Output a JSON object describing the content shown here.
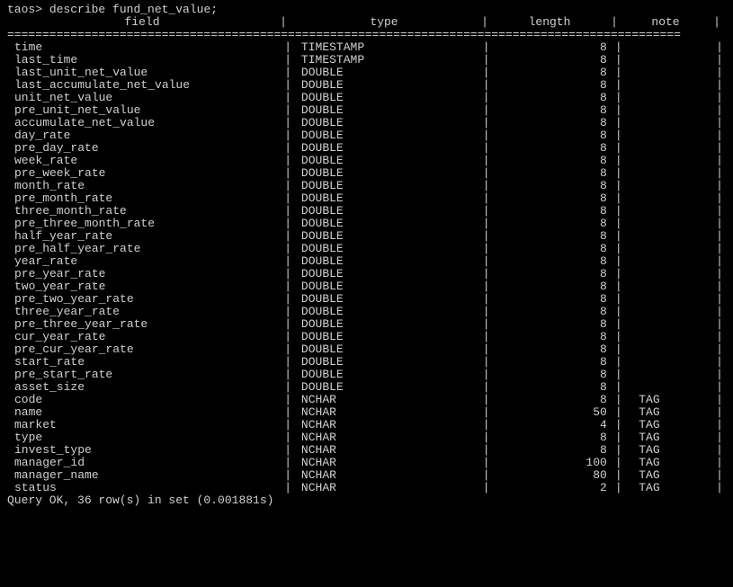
{
  "prompt": "taos>",
  "command": "describe fund_net_value;",
  "columns": {
    "field": "field",
    "type": "type",
    "length": "length",
    "note": "note"
  },
  "separator_line": "================================================================================================",
  "bar": "|",
  "rows": [
    {
      "field": "time",
      "type": "TIMESTAMP",
      "length": "8",
      "note": ""
    },
    {
      "field": "last_time",
      "type": "TIMESTAMP",
      "length": "8",
      "note": ""
    },
    {
      "field": "last_unit_net_value",
      "type": "DOUBLE",
      "length": "8",
      "note": ""
    },
    {
      "field": "last_accumulate_net_value",
      "type": "DOUBLE",
      "length": "8",
      "note": ""
    },
    {
      "field": "unit_net_value",
      "type": "DOUBLE",
      "length": "8",
      "note": ""
    },
    {
      "field": "pre_unit_net_value",
      "type": "DOUBLE",
      "length": "8",
      "note": ""
    },
    {
      "field": "accumulate_net_value",
      "type": "DOUBLE",
      "length": "8",
      "note": ""
    },
    {
      "field": "day_rate",
      "type": "DOUBLE",
      "length": "8",
      "note": ""
    },
    {
      "field": "pre_day_rate",
      "type": "DOUBLE",
      "length": "8",
      "note": ""
    },
    {
      "field": "week_rate",
      "type": "DOUBLE",
      "length": "8",
      "note": ""
    },
    {
      "field": "pre_week_rate",
      "type": "DOUBLE",
      "length": "8",
      "note": ""
    },
    {
      "field": "month_rate",
      "type": "DOUBLE",
      "length": "8",
      "note": ""
    },
    {
      "field": "pre_month_rate",
      "type": "DOUBLE",
      "length": "8",
      "note": ""
    },
    {
      "field": "three_month_rate",
      "type": "DOUBLE",
      "length": "8",
      "note": ""
    },
    {
      "field": "pre_three_month_rate",
      "type": "DOUBLE",
      "length": "8",
      "note": ""
    },
    {
      "field": "half_year_rate",
      "type": "DOUBLE",
      "length": "8",
      "note": ""
    },
    {
      "field": "pre_half_year_rate",
      "type": "DOUBLE",
      "length": "8",
      "note": ""
    },
    {
      "field": "year_rate",
      "type": "DOUBLE",
      "length": "8",
      "note": ""
    },
    {
      "field": "pre_year_rate",
      "type": "DOUBLE",
      "length": "8",
      "note": ""
    },
    {
      "field": "two_year_rate",
      "type": "DOUBLE",
      "length": "8",
      "note": ""
    },
    {
      "field": "pre_two_year_rate",
      "type": "DOUBLE",
      "length": "8",
      "note": ""
    },
    {
      "field": "three_year_rate",
      "type": "DOUBLE",
      "length": "8",
      "note": ""
    },
    {
      "field": "pre_three_year_rate",
      "type": "DOUBLE",
      "length": "8",
      "note": ""
    },
    {
      "field": "cur_year_rate",
      "type": "DOUBLE",
      "length": "8",
      "note": ""
    },
    {
      "field": "pre_cur_year_rate",
      "type": "DOUBLE",
      "length": "8",
      "note": ""
    },
    {
      "field": "start_rate",
      "type": "DOUBLE",
      "length": "8",
      "note": ""
    },
    {
      "field": "pre_start_rate",
      "type": "DOUBLE",
      "length": "8",
      "note": ""
    },
    {
      "field": "asset_size",
      "type": "DOUBLE",
      "length": "8",
      "note": ""
    },
    {
      "field": "code",
      "type": "NCHAR",
      "length": "8",
      "note": "TAG"
    },
    {
      "field": "name",
      "type": "NCHAR",
      "length": "50",
      "note": "TAG"
    },
    {
      "field": "market",
      "type": "NCHAR",
      "length": "4",
      "note": "TAG"
    },
    {
      "field": "type",
      "type": "NCHAR",
      "length": "8",
      "note": "TAG"
    },
    {
      "field": "invest_type",
      "type": "NCHAR",
      "length": "8",
      "note": "TAG"
    },
    {
      "field": "manager_id",
      "type": "NCHAR",
      "length": "100",
      "note": "TAG"
    },
    {
      "field": "manager_name",
      "type": "NCHAR",
      "length": "80",
      "note": "TAG"
    },
    {
      "field": "status",
      "type": "NCHAR",
      "length": "2",
      "note": "TAG"
    }
  ],
  "status": "Query OK, 36 row(s) in set (0.001881s)"
}
